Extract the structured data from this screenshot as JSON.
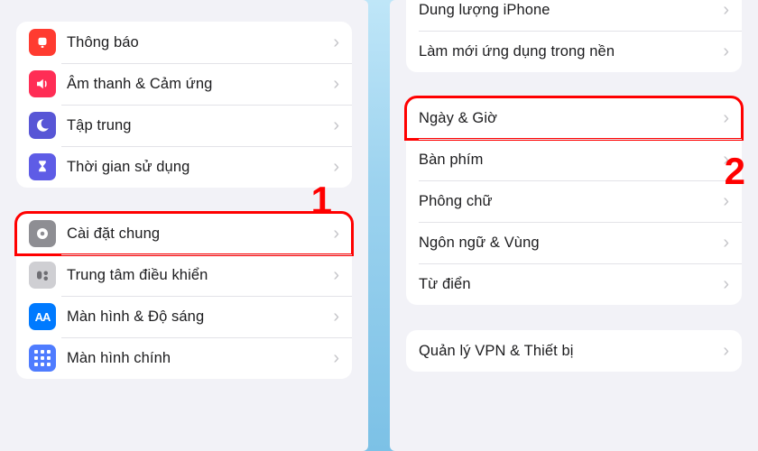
{
  "annotations": {
    "step1": "1",
    "step2": "2"
  },
  "left": {
    "group1": [
      {
        "label": "Thông báo",
        "icon": "bell",
        "color": "ic-red"
      },
      {
        "label": "Âm thanh & Cảm ứng",
        "icon": "speaker",
        "color": "ic-pink"
      },
      {
        "label": "Tập trung",
        "icon": "moon",
        "color": "ic-indigo"
      },
      {
        "label": "Thời gian sử dụng",
        "icon": "hourglass",
        "color": "ic-purple"
      }
    ],
    "group2": [
      {
        "label": "Cài đặt chung",
        "icon": "gear",
        "color": "ic-gray",
        "highlight": true
      },
      {
        "label": "Trung tâm điều khiển",
        "icon": "sliders",
        "color": "ic-lgray"
      },
      {
        "label": "Màn hình & Độ sáng",
        "icon": "aa",
        "color": "ic-blue"
      },
      {
        "label": "Màn hình chính",
        "icon": "grid",
        "color": "ic-blue2"
      }
    ]
  },
  "right": {
    "group1": [
      {
        "label": "Dung lượng iPhone"
      },
      {
        "label": "Làm mới ứng dụng trong nền"
      }
    ],
    "group2": [
      {
        "label": "Ngày & Giờ",
        "highlight": true
      },
      {
        "label": "Bàn phím"
      },
      {
        "label": "Phông chữ"
      },
      {
        "label": "Ngôn ngữ & Vùng"
      },
      {
        "label": "Từ điển"
      }
    ],
    "group3": [
      {
        "label": "Quản lý VPN & Thiết bị"
      }
    ]
  }
}
